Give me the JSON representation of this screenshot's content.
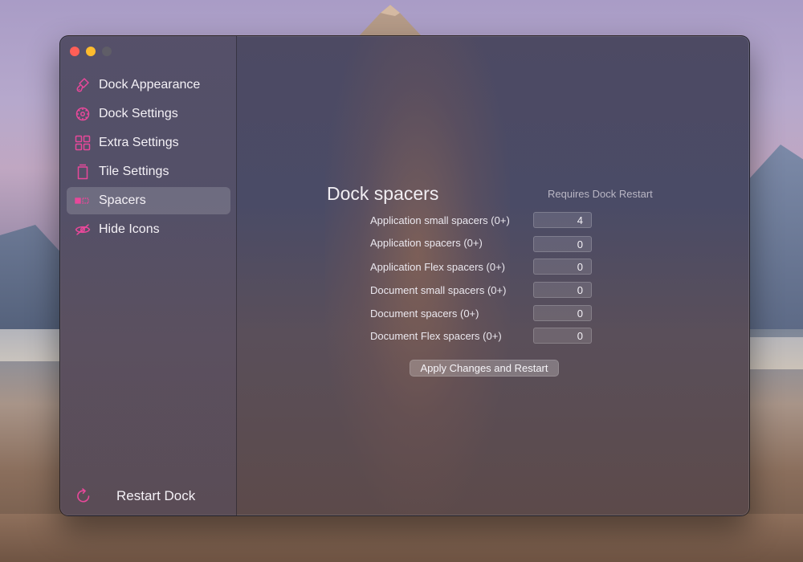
{
  "window": {
    "traffic_lights": [
      "close",
      "minimize",
      "zoom"
    ]
  },
  "sidebar": {
    "items": [
      {
        "label": "Dock Appearance",
        "icon": "paintbrush-icon",
        "active": false
      },
      {
        "label": "Dock Settings",
        "icon": "gear-icon",
        "active": false
      },
      {
        "label": "Extra Settings",
        "icon": "grid-icon",
        "active": false
      },
      {
        "label": "Tile Settings",
        "icon": "trash-tile-icon",
        "active": false
      },
      {
        "label": "Spacers",
        "icon": "spacer-icon",
        "active": true
      },
      {
        "label": "Hide Icons",
        "icon": "eye-slash-icon",
        "active": false
      }
    ],
    "restart_label": "Restart Dock",
    "accent_color": "#e8489a"
  },
  "main": {
    "title": "Dock spacers",
    "note": "Requires Dock Restart",
    "fields": [
      {
        "label": "Application small spacers (0+)",
        "value": "4"
      },
      {
        "label": "Application spacers (0+)",
        "value": "0"
      },
      {
        "label": "Application Flex spacers (0+)",
        "value": "0"
      },
      {
        "label": "Document small spacers (0+)",
        "value": "0"
      },
      {
        "label": "Document spacers (0+)",
        "value": "0"
      },
      {
        "label": "Document Flex spacers (0+)",
        "value": "0"
      }
    ],
    "apply_label": "Apply Changes and Restart"
  }
}
